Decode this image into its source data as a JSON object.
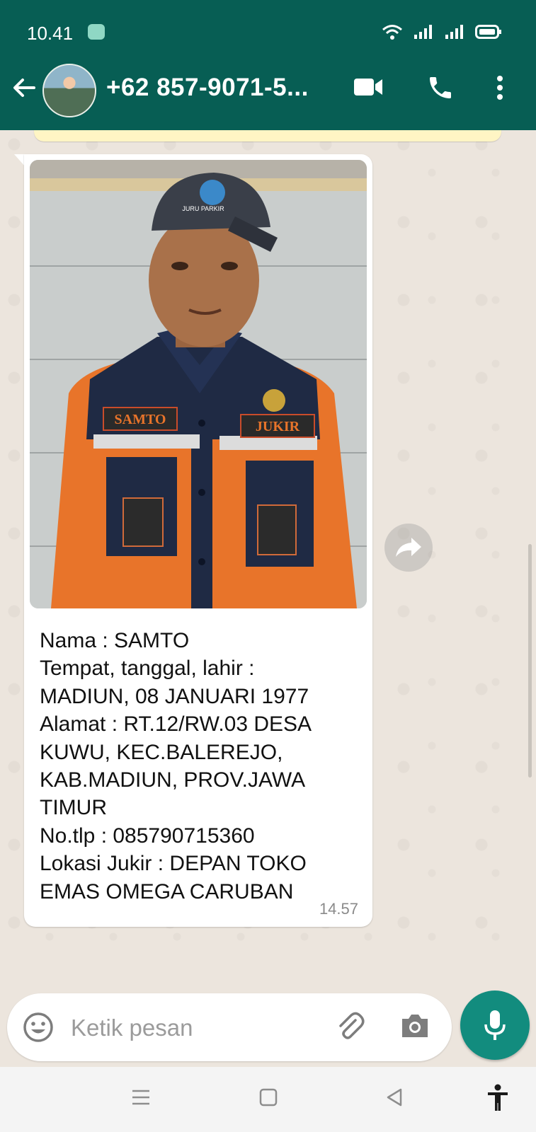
{
  "status_bar": {
    "time": "10.41"
  },
  "header": {
    "contact_name": "+62 857-9071-5..."
  },
  "message": {
    "caption_lines": [
      "Nama   :  SAMTO",
      "Tempat, tanggal, lahir  :",
      "MADIUN, 08 JANUARI 1977",
      "Alamat  : RT.12/RW.03 DESA",
      "KUWU, KEC.BALEREJO,",
      "KAB.MADIUN, PROV.JAWA",
      "TIMUR",
      "No.tlp       : 085790715360",
      "Lokasi Jukir  : DEPAN TOKO",
      "EMAS OMEGA CARUBAN"
    ],
    "time": "14.57",
    "photo_patches": {
      "name_patch": "SAMTO",
      "role_patch": "JUKIR",
      "cap_text": "JURU PARKIR"
    }
  },
  "composer": {
    "placeholder": "Ketik pesan"
  },
  "colors": {
    "header": "#075e54",
    "accent": "#128c7e",
    "chat_bg": "#ece5dd",
    "bubble": "#ffffff"
  }
}
